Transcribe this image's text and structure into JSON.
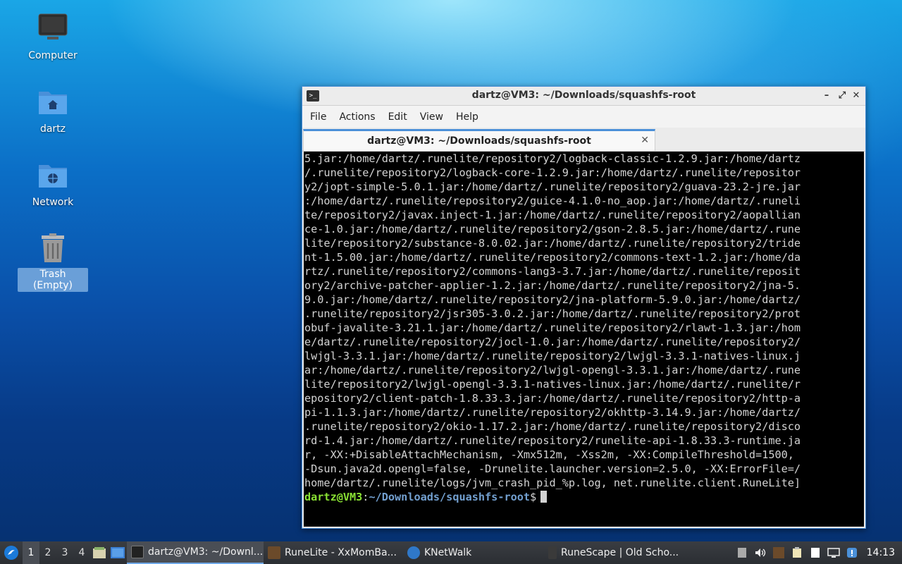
{
  "desktop": {
    "icons": [
      {
        "label": "Computer",
        "icon": "computer-icon"
      },
      {
        "label": "dartz",
        "icon": "home-folder-icon"
      },
      {
        "label": "Network",
        "icon": "network-folder-icon"
      },
      {
        "label": "Trash (Empty)",
        "icon": "trash-icon"
      }
    ]
  },
  "window": {
    "title": "dartz@VM3: ~/Downloads/squashfs-root",
    "menu": [
      "File",
      "Actions",
      "Edit",
      "View",
      "Help"
    ],
    "tab_label": "dartz@VM3: ~/Downloads/squashfs-root",
    "terminal_lines": [
      "5.jar:/home/dartz/.runelite/repository2/logback-classic-1.2.9.jar:/home/dartz",
      "/.runelite/repository2/logback-core-1.2.9.jar:/home/dartz/.runelite/repositor",
      "y2/jopt-simple-5.0.1.jar:/home/dartz/.runelite/repository2/guava-23.2-jre.jar",
      ":/home/dartz/.runelite/repository2/guice-4.1.0-no_aop.jar:/home/dartz/.runeli",
      "te/repository2/javax.inject-1.jar:/home/dartz/.runelite/repository2/aopallian",
      "ce-1.0.jar:/home/dartz/.runelite/repository2/gson-2.8.5.jar:/home/dartz/.rune",
      "lite/repository2/substance-8.0.02.jar:/home/dartz/.runelite/repository2/tride",
      "nt-1.5.00.jar:/home/dartz/.runelite/repository2/commons-text-1.2.jar:/home/da",
      "rtz/.runelite/repository2/commons-lang3-3.7.jar:/home/dartz/.runelite/reposit",
      "ory2/archive-patcher-applier-1.2.jar:/home/dartz/.runelite/repository2/jna-5.",
      "9.0.jar:/home/dartz/.runelite/repository2/jna-platform-5.9.0.jar:/home/dartz/",
      ".runelite/repository2/jsr305-3.0.2.jar:/home/dartz/.runelite/repository2/prot",
      "obuf-javalite-3.21.1.jar:/home/dartz/.runelite/repository2/rlawt-1.3.jar:/hom",
      "e/dartz/.runelite/repository2/jocl-1.0.jar:/home/dartz/.runelite/repository2/",
      "lwjgl-3.3.1.jar:/home/dartz/.runelite/repository2/lwjgl-3.3.1-natives-linux.j",
      "ar:/home/dartz/.runelite/repository2/lwjgl-opengl-3.3.1.jar:/home/dartz/.rune",
      "lite/repository2/lwjgl-opengl-3.3.1-natives-linux.jar:/home/dartz/.runelite/r",
      "epository2/client-patch-1.8.33.3.jar:/home/dartz/.runelite/repository2/http-a",
      "pi-1.1.3.jar:/home/dartz/.runelite/repository2/okhttp-3.14.9.jar:/home/dartz/",
      ".runelite/repository2/okio-1.17.2.jar:/home/dartz/.runelite/repository2/disco",
      "rd-1.4.jar:/home/dartz/.runelite/repository2/runelite-api-1.8.33.3-runtime.ja",
      "r, -XX:+DisableAttachMechanism, -Xmx512m, -Xss2m, -XX:CompileThreshold=1500,",
      "-Dsun.java2d.opengl=false, -Drunelite.launcher.version=2.5.0, -XX:ErrorFile=/",
      "home/dartz/.runelite/logs/jvm_crash_pid_%p.log, net.runelite.client.RuneLite]"
    ],
    "prompt_user": "dartz@VM3",
    "prompt_colon": ":",
    "prompt_path": "~/Downloads/squashfs-root",
    "prompt_symbol": "$"
  },
  "taskbar": {
    "workspaces": [
      "1",
      "2",
      "3",
      "4"
    ],
    "active_workspace": "1",
    "tasks": [
      {
        "label": "dartz@VM3: ~/Downl...",
        "icon": "terminal-icon",
        "active": true
      },
      {
        "label": "RuneLite - XxMomBa...",
        "icon": "runelite-icon",
        "active": false
      },
      {
        "label": "KNetWalk",
        "icon": "knetwalk-icon",
        "active": false
      },
      {
        "label": "RuneScape | Old Scho...",
        "icon": "runescape-icon",
        "active": false
      }
    ],
    "clock": "14:13"
  },
  "colors": {
    "window_border": "#4a8fd8",
    "terminal_bg": "#000000",
    "prompt_user": "#8ae234",
    "prompt_path": "#729fcf",
    "taskbar_bg": "#2b2e33"
  }
}
